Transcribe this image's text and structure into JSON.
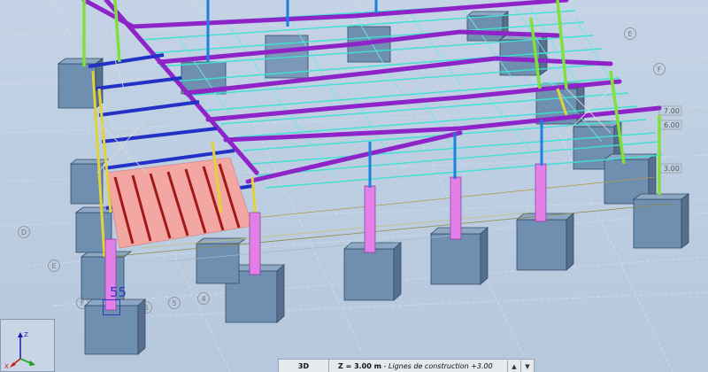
{
  "viewport": {
    "grid_labels": [
      "E",
      "F",
      "D",
      "E",
      "F",
      "6",
      "5",
      "4"
    ],
    "level_labels": [
      "7.00",
      "6.00",
      "3.00"
    ],
    "node_number": "55"
  },
  "axis_widget": {
    "z_label": "Z",
    "x_label": "X"
  },
  "statusbar": {
    "view_mode": "3D",
    "z_label": "Z = 3.00 m",
    "separator": " - ",
    "level_name": "Lignes de construction +3.00"
  },
  "colors": {
    "background": "#bccde2",
    "footing": "#6f8fb0",
    "column_pink": "#e27fe9",
    "rafter_purple": "#8e23c8",
    "purlin_cyan": "#3fe0d4",
    "blue_beam": "#2231c6",
    "green_member": "#7fe03a",
    "yellow_member": "#e1d23a",
    "red_joist": "#a21818",
    "slab_pink": "#f2a7a2",
    "column_blue": "#1f7fe0"
  }
}
